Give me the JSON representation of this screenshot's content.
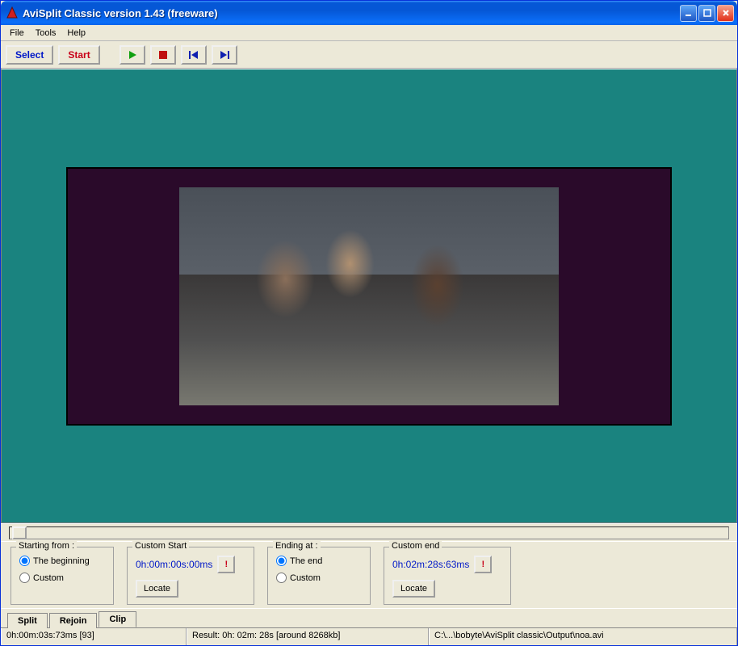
{
  "title": "AviSplit Classic version 1.43 (freeware)",
  "menu": {
    "file": "File",
    "tools": "Tools",
    "help": "Help"
  },
  "toolbar": {
    "select": "Select",
    "start": "Start"
  },
  "slider": {
    "position": 3
  },
  "panel": {
    "start": {
      "title": "Starting from :",
      "opt1": "The beginning",
      "opt2": "Custom",
      "custom_title": "Custom Start",
      "time": "0h:00m:00s:00ms",
      "locate": "Locate",
      "exc": "!"
    },
    "end": {
      "title": "Ending at :",
      "opt1": "The end",
      "opt2": "Custom",
      "custom_title": "Custom end",
      "time": "0h:02m:28s:63ms",
      "locate": "Locate",
      "exc": "!"
    }
  },
  "tabs": {
    "split": "Split",
    "rejoin": "Rejoin",
    "clip": "Clip"
  },
  "status": {
    "time": "0h:00m:03s:73ms [93]",
    "result": "Result: 0h: 02m: 28s [around 8268kb]",
    "path": "C:\\...\\bobyte\\AviSplit classic\\Output\\noa.avi"
  }
}
